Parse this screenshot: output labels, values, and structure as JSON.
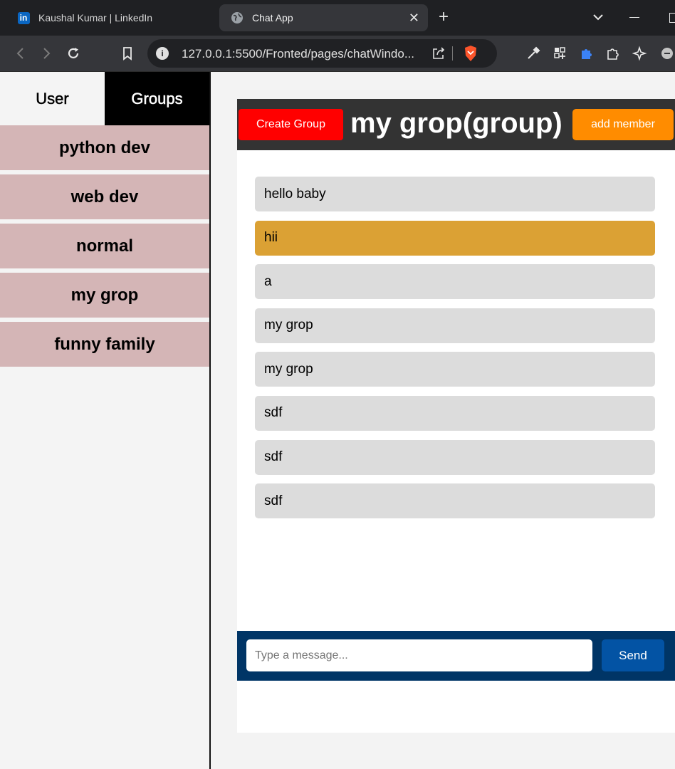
{
  "browser": {
    "tabs": [
      {
        "title": "Kaushal Kumar | LinkedIn",
        "favicon": "linkedin-icon",
        "active": false
      },
      {
        "title": "Chat App",
        "favicon": "globe-icon",
        "active": true
      }
    ],
    "url": "127.0.0.1:5500/Fronted/pages/chatWindo...",
    "favicon_letters": "in"
  },
  "sidebar": {
    "tabs": [
      {
        "label": "User",
        "active": false
      },
      {
        "label": "Groups",
        "active": true
      }
    ],
    "groups": [
      "python dev",
      "web dev",
      "normal",
      "my grop",
      "funny family"
    ]
  },
  "chat": {
    "create_group_label": "Create Group",
    "title": "my grop(group)",
    "add_member_label": "add member",
    "messages": [
      {
        "text": "hello baby",
        "highlight": false
      },
      {
        "text": "hii",
        "highlight": true
      },
      {
        "text": "a",
        "highlight": false
      },
      {
        "text": "my grop",
        "highlight": false
      },
      {
        "text": "my grop",
        "highlight": false
      },
      {
        "text": "sdf",
        "highlight": false
      },
      {
        "text": "sdf",
        "highlight": false
      },
      {
        "text": "sdf",
        "highlight": false
      }
    ],
    "input_placeholder": "Type a message...",
    "send_label": "Send"
  },
  "colors": {
    "group_item": "#d4b5b6",
    "create_button": "#ff0000",
    "add_member_button": "#ff8c00",
    "highlight_message": "#dba134",
    "composer_bar": "#003566",
    "send_button": "#0353a4"
  }
}
